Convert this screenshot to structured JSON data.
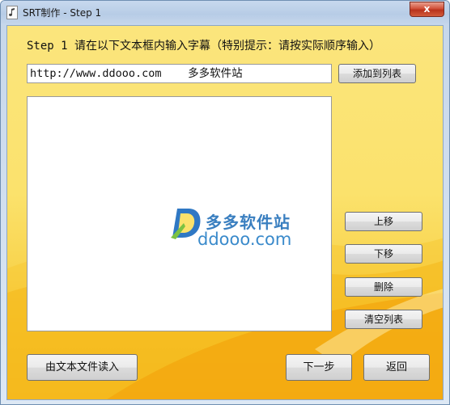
{
  "window": {
    "title": "SRT制作 - Step 1",
    "close_label": "x",
    "icon": "music-document-icon"
  },
  "step": {
    "label": "Step 1  请在以下文本框内输入字幕（特别提示：请按实际顺序输入）"
  },
  "subtitle_input": {
    "value": "http://www.ddooo.com    多多软件站"
  },
  "buttons": {
    "add_to_list": "添加到列表",
    "move_up": "上移",
    "move_down": "下移",
    "delete": "删除",
    "clear_list": "清空列表",
    "import_from_text": "由文本文件读入",
    "next": "下一步",
    "back": "返回"
  },
  "list": {
    "items": []
  },
  "watermark": {
    "cn": "多多软件站",
    "en": "ddooo.com",
    "icon": "ddooo-logo-icon"
  },
  "colors": {
    "background_top": "#fbe57d",
    "background_bottom": "#f1a706",
    "close_button": "#c8432a",
    "watermark": "#3a7fc0"
  }
}
